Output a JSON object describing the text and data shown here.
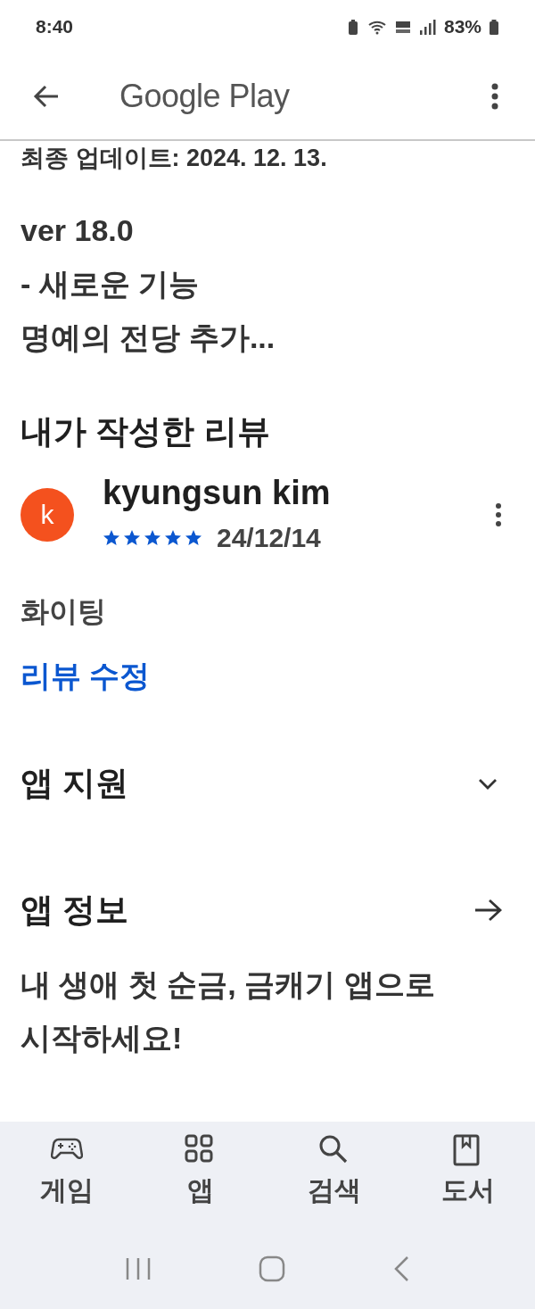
{
  "status_bar": {
    "time": "8:40",
    "battery": "83%"
  },
  "header": {
    "title": "Google Play"
  },
  "updated": "최종 업데이트: 2024. 12. 13.",
  "whats_new": [
    "ver 18.0",
    "- 새로운 기능",
    "명예의 전당 추가..."
  ],
  "my_review": {
    "heading": "내가 작성한 리뷰",
    "avatar_letter": "k",
    "author": "kyungsun kim",
    "stars": 5,
    "date": "24/12/14",
    "text": "화이팅",
    "edit_link": "리뷰 수정"
  },
  "sections": [
    {
      "kind": "expand",
      "title": "앱 지원"
    },
    {
      "kind": "link",
      "title": "앱 정보"
    }
  ],
  "description": "내 생애 첫 순금, 금캐기 앱으로 시작하세요!",
  "bottom_nav": [
    {
      "kind": "games",
      "label": "게임"
    },
    {
      "kind": "apps",
      "label": "앱"
    },
    {
      "kind": "search",
      "label": "검색"
    },
    {
      "kind": "books",
      "label": "도서"
    }
  ]
}
